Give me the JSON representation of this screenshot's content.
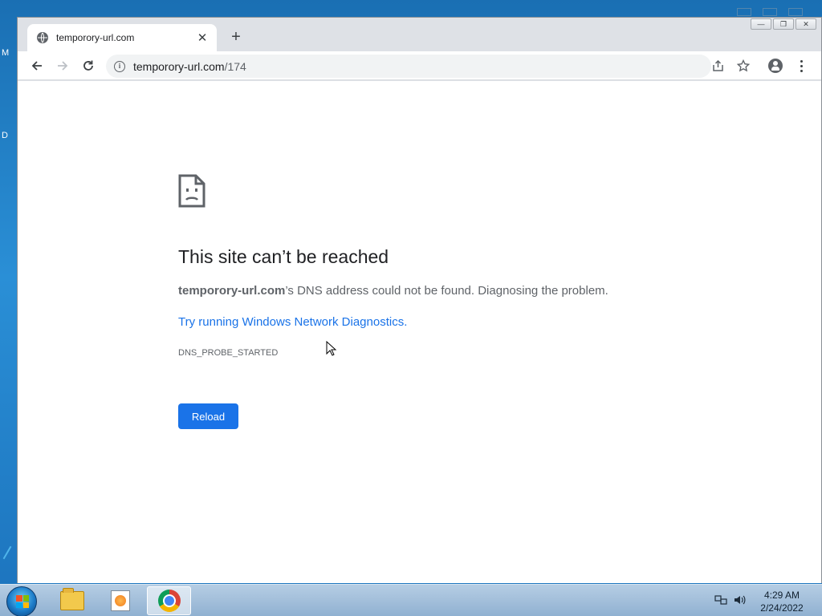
{
  "desktop": {
    "edge_text_1": "M",
    "edge_text_2": "D"
  },
  "window": {
    "controls": [
      "—",
      "❐",
      "✕"
    ]
  },
  "tab": {
    "title": "temporory-url.com",
    "favicon": "globe-icon",
    "close_label": "✕"
  },
  "new_tab_label": "+",
  "toolbar": {
    "back_icon": "back-arrow-icon",
    "forward_icon": "forward-arrow-icon",
    "reload_icon": "reload-icon",
    "url_host": "temporory-url.com",
    "url_path": "/174",
    "share_icon": "share-icon",
    "bookmark_icon": "star-icon",
    "profile_icon": "profile-icon",
    "menu_icon": "kebab-menu-icon"
  },
  "error_page": {
    "icon": "sad-page-icon",
    "title": "This site can’t be reached",
    "description_host": "temporory-url.com",
    "description_rest": "’s DNS address could not be found. Diagnosing the problem.",
    "link_text": "Try running Windows Network Diagnostics.",
    "error_code": "DNS_PROBE_STARTED",
    "reload_button": "Reload"
  },
  "taskbar": {
    "apps": [
      "file-explorer-icon",
      "media-player-icon",
      "chrome-icon"
    ],
    "active_app": "chrome-icon",
    "tray_icons": [
      "network-icon",
      "volume-icon"
    ],
    "time": "4:29 AM",
    "date": "2/24/2022"
  },
  "colors": {
    "link": "#1a73e8",
    "button": "#1a73e8",
    "title_text": "#202124",
    "secondary_text": "#5f6368"
  }
}
